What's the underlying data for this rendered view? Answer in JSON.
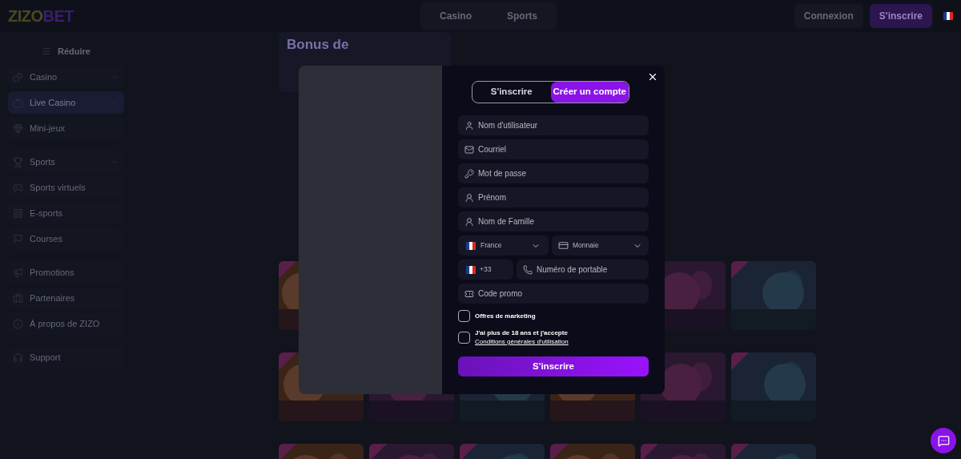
{
  "header": {
    "logo": [
      "ZIZO",
      "BET"
    ],
    "nav": [
      {
        "label": "Casino",
        "selected": false
      },
      {
        "label": "Sports",
        "selected": false
      }
    ],
    "login": "Connexion",
    "signup": "S'inscrire"
  },
  "sidebar": {
    "collapse": "Réduire",
    "groups": [
      [
        {
          "label": "Casino",
          "expandable": true,
          "selected": false
        },
        {
          "label": "Live Casino",
          "expandable": true,
          "selected": true
        },
        {
          "label": "Mini-jeux",
          "expandable": false,
          "selected": false
        }
      ],
      [
        {
          "label": "Sports",
          "expandable": true,
          "selected": false
        },
        {
          "label": "Sports virtuels",
          "expandable": false,
          "selected": false
        },
        {
          "label": "E-sports",
          "expandable": false,
          "selected": false
        },
        {
          "label": "Courses",
          "expandable": false,
          "selected": false
        }
      ],
      [
        {
          "label": "Promotions",
          "expandable": false,
          "selected": false
        },
        {
          "label": "Partenaires",
          "expandable": false,
          "selected": false
        },
        {
          "label": "À propos de ZIZO",
          "expandable": false,
          "selected": false
        }
      ],
      [
        {
          "label": "Support",
          "expandable": false,
          "selected": false
        }
      ]
    ]
  },
  "hero": {
    "title": "Bonus de"
  },
  "modal": {
    "tabs": [
      {
        "label": "S'inscrire",
        "selected": false
      },
      {
        "label": "Créer un compte",
        "selected": true
      }
    ],
    "fields": [
      {
        "placeholder": "Nom d'utilisateur"
      },
      {
        "placeholder": "Courriel"
      },
      {
        "placeholder": "Mot de passe"
      },
      {
        "placeholder": "Prénom"
      },
      {
        "placeholder": "Nom de Famille"
      }
    ],
    "country": "France",
    "currency": "Monnaie",
    "phone_code": "+33",
    "phone": {
      "placeholder": "Numéro de portable"
    },
    "promo": {
      "placeholder": "Code promo"
    },
    "checks": [
      {
        "label": "Offres de marketing",
        "checked": false
      },
      {
        "label": "J'ai plus de 18 ans et j'accepte",
        "link": "Conditions générales d'utilisation",
        "checked": false
      }
    ],
    "submit": "S'inscrire"
  }
}
